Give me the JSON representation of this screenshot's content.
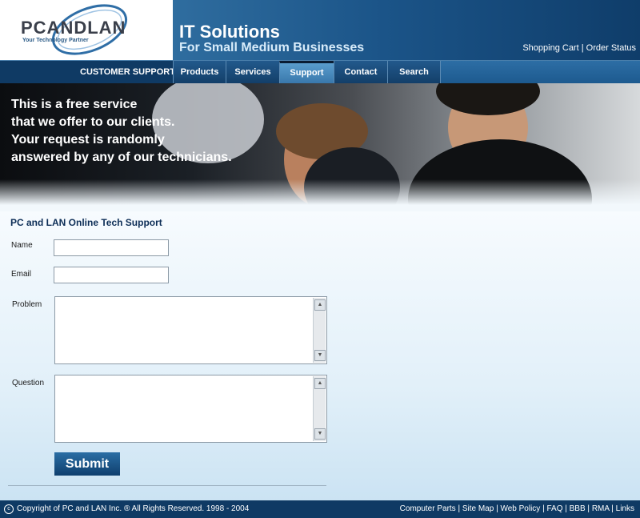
{
  "logo": {
    "text": "PCANDLAN",
    "tagline": "Your Technology Partner"
  },
  "header": {
    "title": "IT Solutions",
    "subtitle": "For Small Medium Businesses",
    "link_cart": "Shopping Cart",
    "separator": " | ",
    "link_order": "Order Status"
  },
  "nav": {
    "section_label": "CUSTOMER SUPPORT",
    "items": [
      {
        "label": "Products"
      },
      {
        "label": "Services"
      },
      {
        "label": "Support"
      },
      {
        "label": "Contact"
      },
      {
        "label": "Search"
      }
    ],
    "active": "Support"
  },
  "banner": {
    "lines": [
      "This is a free service",
      "that we offer to our clients.",
      "Your request is randomly",
      "answered by any of our technicians."
    ]
  },
  "form": {
    "title": "PC and LAN Online Tech Support",
    "name_label": "Name",
    "name_value": "",
    "email_label": "Email",
    "email_value": "",
    "problem_label": "Problem",
    "problem_value": "",
    "question_label": "Question",
    "question_value": "",
    "submit_label": "Submit"
  },
  "footer": {
    "copyright": "Copyright of PC and LAN Inc. ® All Rights Reserved. 1998 - 2004",
    "links": [
      "Computer Parts",
      "Site Map",
      "Web Policy",
      "FAQ",
      "BBB",
      "RMA",
      "Links"
    ]
  },
  "icons": [
    "logo-swoosh-icon",
    "copyright-icon",
    "scroll-up-icon",
    "scroll-down-icon"
  ],
  "colors": {
    "brand_dark": "#0f3a64",
    "brand_mid": "#1b5488",
    "nav_active": "#3978ac"
  }
}
